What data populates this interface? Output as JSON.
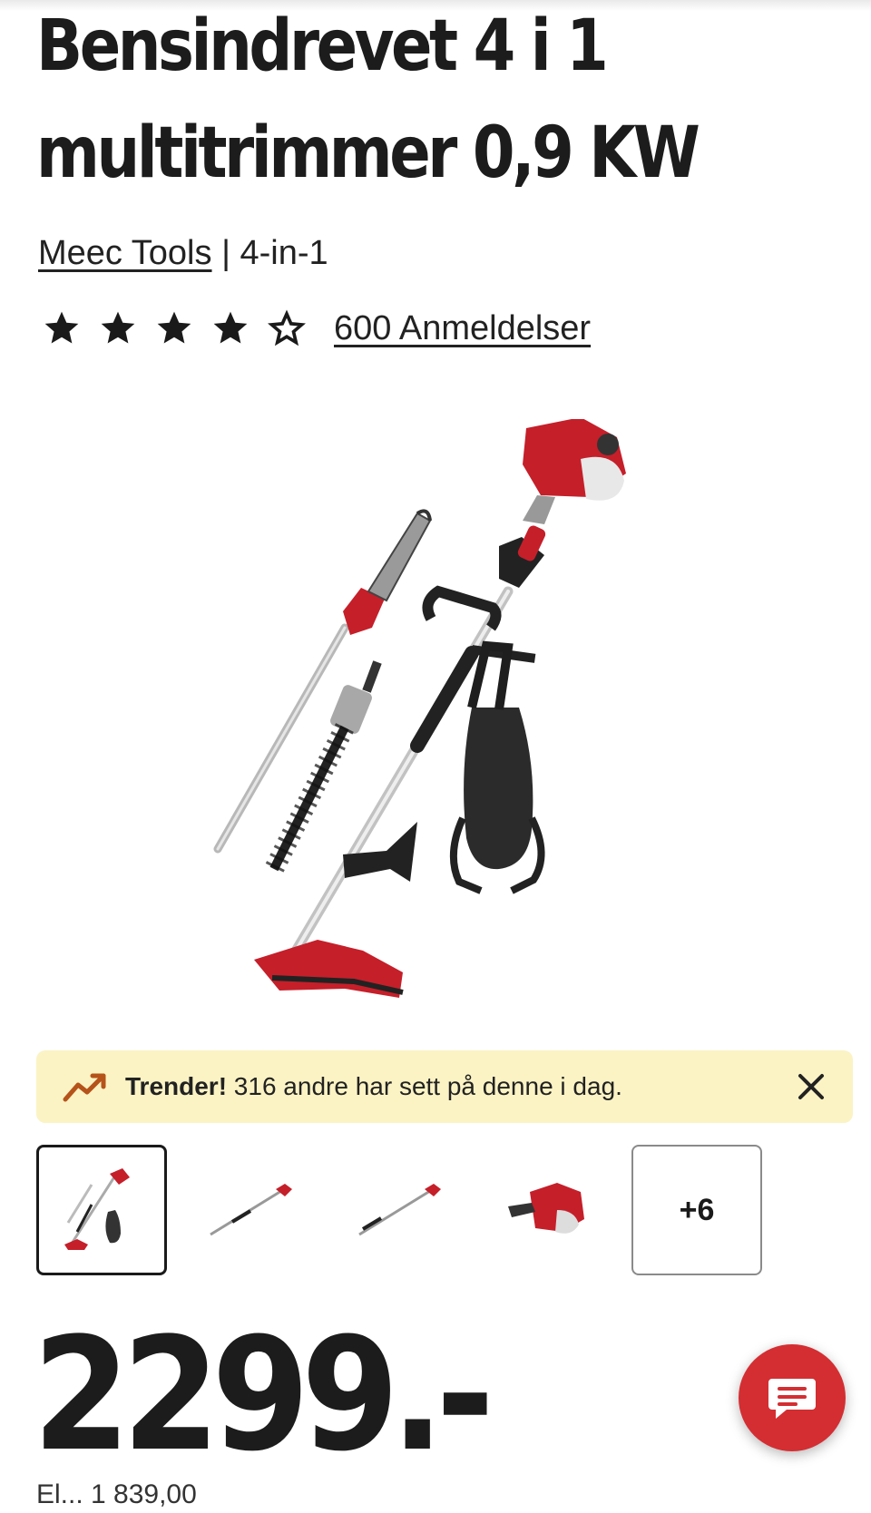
{
  "product": {
    "title_line1": "Bensindrevet 4 i 1",
    "title_line2": "multitrimmer 0,9 KW",
    "brand": "Meec Tools",
    "separator": " | ",
    "variant": "4-in-1",
    "rating_stars": 4,
    "rating_max": 5,
    "reviews_label": "600 Anmeldelser"
  },
  "trend_banner": {
    "strong": "Trender!",
    "text": " 316 andre har sett på denne i dag.",
    "icon": "trending-up-icon"
  },
  "gallery": {
    "more_label": "+6",
    "thumbnails": [
      "full-kit",
      "pole-saw",
      "pole-hedge-trimmer",
      "engine"
    ]
  },
  "price": {
    "value": "2299.-"
  },
  "bottom_partial": "El...        1 839,00",
  "colors": {
    "accent_red": "#d42e32",
    "banner_bg": "#fbf3c4",
    "trend_icon": "#b5531a",
    "text": "#1a1a1a"
  },
  "chat": {
    "icon": "chat-icon"
  }
}
